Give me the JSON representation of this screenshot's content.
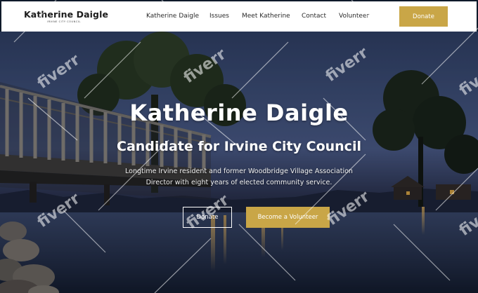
{
  "brand": {
    "name": "Katherine Daigle",
    "subtitle": "IRVINE CITY COUNCIL"
  },
  "nav": {
    "items": [
      {
        "label": "Katherine Daigle"
      },
      {
        "label": "Issues"
      },
      {
        "label": "Meet Katherine"
      },
      {
        "label": "Contact"
      },
      {
        "label": "Volunteer"
      }
    ],
    "donate_label": "Donate"
  },
  "hero": {
    "title": "Katherine Daigle",
    "subtitle": "Candidate for Irvine City Council",
    "description": "Longtime Irvine resident and former Woodbridge Village Association Director with eight years of elected community service.",
    "donate_label": "Donate",
    "volunteer_label": "Become a Volunteer"
  },
  "watermark": {
    "text": "fiverr"
  },
  "colors": {
    "accent_gold": "#c9a647",
    "header_bg": "#ffffff",
    "text_dark": "#1c1c1c"
  }
}
